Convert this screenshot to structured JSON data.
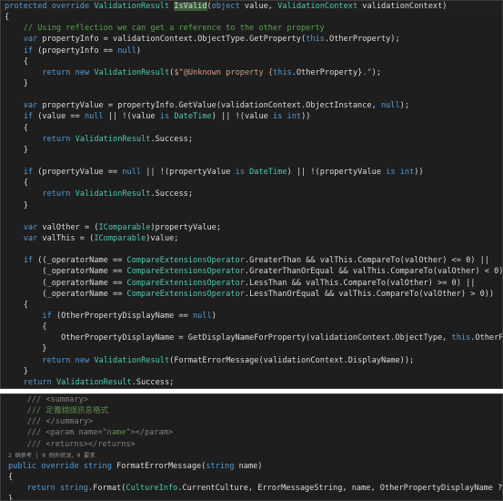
{
  "top_panel": {
    "lines": [
      [
        {
          "t": "protected override ",
          "c": "kw"
        },
        {
          "t": "ValidationResult",
          "c": "ty"
        },
        {
          "t": " ",
          "c": ""
        },
        {
          "t": "IsValid",
          "c": "hl"
        },
        {
          "t": "(",
          "c": ""
        },
        {
          "t": "object",
          "c": "kw"
        },
        {
          "t": " value, ",
          "c": ""
        },
        {
          "t": "ValidationContext",
          "c": "ty"
        },
        {
          "t": " validationContext)",
          "c": ""
        }
      ],
      [
        {
          "t": "{",
          "c": ""
        }
      ],
      [
        {
          "t": "    // Using reflection we can get a reference to the other property",
          "c": "cm"
        }
      ],
      [
        {
          "t": "    ",
          "c": ""
        },
        {
          "t": "var",
          "c": "kw"
        },
        {
          "t": " propertyInfo = validationContext.ObjectType.GetProperty(",
          "c": ""
        },
        {
          "t": "this",
          "c": "kw"
        },
        {
          "t": ".OtherProperty);",
          "c": ""
        }
      ],
      [
        {
          "t": "    ",
          "c": ""
        },
        {
          "t": "if",
          "c": "kw"
        },
        {
          "t": " (propertyInfo == ",
          "c": ""
        },
        {
          "t": "null",
          "c": "kw"
        },
        {
          "t": ")",
          "c": ""
        }
      ],
      [
        {
          "t": "    {",
          "c": ""
        }
      ],
      [
        {
          "t": "        ",
          "c": ""
        },
        {
          "t": "return",
          "c": "kw"
        },
        {
          "t": " ",
          "c": ""
        },
        {
          "t": "new",
          "c": "kw"
        },
        {
          "t": " ",
          "c": ""
        },
        {
          "t": "ValidationResult",
          "c": "ty"
        },
        {
          "t": "(",
          "c": ""
        },
        {
          "t": "$\"@Unknown property {",
          "c": "st"
        },
        {
          "t": "this",
          "c": "kw"
        },
        {
          "t": ".OtherProperty}",
          "c": ""
        },
        {
          "t": ".\"",
          "c": "st"
        },
        {
          "t": ");",
          "c": ""
        }
      ],
      [
        {
          "t": "    }",
          "c": ""
        }
      ],
      [
        {
          "t": "",
          "c": ""
        }
      ],
      [
        {
          "t": "    ",
          "c": ""
        },
        {
          "t": "var",
          "c": "kw"
        },
        {
          "t": " propertyValue = propertyInfo.GetValue(validationContext.ObjectInstance, ",
          "c": ""
        },
        {
          "t": "null",
          "c": "kw"
        },
        {
          "t": ");",
          "c": ""
        }
      ],
      [
        {
          "t": "    ",
          "c": ""
        },
        {
          "t": "if",
          "c": "kw"
        },
        {
          "t": " (value == ",
          "c": ""
        },
        {
          "t": "null",
          "c": "kw"
        },
        {
          "t": " || !(value ",
          "c": ""
        },
        {
          "t": "is",
          "c": "kw"
        },
        {
          "t": " ",
          "c": ""
        },
        {
          "t": "DateTime",
          "c": "ty"
        },
        {
          "t": ") || !(value ",
          "c": ""
        },
        {
          "t": "is",
          "c": "kw"
        },
        {
          "t": " ",
          "c": ""
        },
        {
          "t": "int",
          "c": "kw"
        },
        {
          "t": "))",
          "c": ""
        }
      ],
      [
        {
          "t": "    {",
          "c": ""
        }
      ],
      [
        {
          "t": "        ",
          "c": ""
        },
        {
          "t": "return",
          "c": "kw"
        },
        {
          "t": " ",
          "c": ""
        },
        {
          "t": "ValidationResult",
          "c": "ty"
        },
        {
          "t": ".Success;",
          "c": ""
        }
      ],
      [
        {
          "t": "    }",
          "c": ""
        }
      ],
      [
        {
          "t": "",
          "c": ""
        }
      ],
      [
        {
          "t": "    ",
          "c": ""
        },
        {
          "t": "if",
          "c": "kw"
        },
        {
          "t": " (propertyValue == ",
          "c": ""
        },
        {
          "t": "null",
          "c": "kw"
        },
        {
          "t": " || !(propertyValue ",
          "c": ""
        },
        {
          "t": "is",
          "c": "kw"
        },
        {
          "t": " ",
          "c": ""
        },
        {
          "t": "DateTime",
          "c": "ty"
        },
        {
          "t": ") || !(propertyValue ",
          "c": ""
        },
        {
          "t": "is",
          "c": "kw"
        },
        {
          "t": " ",
          "c": ""
        },
        {
          "t": "int",
          "c": "kw"
        },
        {
          "t": "))",
          "c": ""
        }
      ],
      [
        {
          "t": "    {",
          "c": ""
        }
      ],
      [
        {
          "t": "        ",
          "c": ""
        },
        {
          "t": "return",
          "c": "kw"
        },
        {
          "t": " ",
          "c": ""
        },
        {
          "t": "ValidationResult",
          "c": "ty"
        },
        {
          "t": ".Success;",
          "c": ""
        }
      ],
      [
        {
          "t": "    }",
          "c": ""
        }
      ],
      [
        {
          "t": "",
          "c": ""
        }
      ],
      [
        {
          "t": "    ",
          "c": ""
        },
        {
          "t": "var",
          "c": "kw"
        },
        {
          "t": " valOther = (",
          "c": ""
        },
        {
          "t": "IComparable",
          "c": "ty"
        },
        {
          "t": ")propertyValue;",
          "c": ""
        }
      ],
      [
        {
          "t": "    ",
          "c": ""
        },
        {
          "t": "var",
          "c": "kw"
        },
        {
          "t": " valThis = (",
          "c": ""
        },
        {
          "t": "IComparable",
          "c": "ty"
        },
        {
          "t": ")value;",
          "c": ""
        }
      ],
      [
        {
          "t": "",
          "c": ""
        }
      ],
      [
        {
          "t": "    ",
          "c": ""
        },
        {
          "t": "if",
          "c": "kw"
        },
        {
          "t": " ((_operatorName == ",
          "c": ""
        },
        {
          "t": "CompareExtensionsOperator",
          "c": "ty"
        },
        {
          "t": ".GreaterThan && valThis.CompareTo(valOther) <= 0) ||",
          "c": ""
        }
      ],
      [
        {
          "t": "        (_operatorName == ",
          "c": ""
        },
        {
          "t": "CompareExtensionsOperator",
          "c": "ty"
        },
        {
          "t": ".GreaterThanOrEqual && valThis.CompareTo(valOther) < 0) ||",
          "c": ""
        }
      ],
      [
        {
          "t": "        (_operatorName == ",
          "c": ""
        },
        {
          "t": "CompareExtensionsOperator",
          "c": "ty"
        },
        {
          "t": ".LessThan && valThis.CompareTo(valOther) >= 0) ||",
          "c": ""
        }
      ],
      [
        {
          "t": "        (_operatorName == ",
          "c": ""
        },
        {
          "t": "CompareExtensionsOperator",
          "c": "ty"
        },
        {
          "t": ".LessThanOrEqual && valThis.CompareTo(valOther) > 0))",
          "c": ""
        }
      ],
      [
        {
          "t": "    {",
          "c": ""
        }
      ],
      [
        {
          "t": "        ",
          "c": ""
        },
        {
          "t": "if",
          "c": "kw"
        },
        {
          "t": " (OtherPropertyDisplayName == ",
          "c": ""
        },
        {
          "t": "null",
          "c": "kw"
        },
        {
          "t": ")",
          "c": ""
        }
      ],
      [
        {
          "t": "        {",
          "c": ""
        }
      ],
      [
        {
          "t": "            OtherPropertyDisplayName = GetDisplayNameForProperty(validationContext.ObjectType, ",
          "c": ""
        },
        {
          "t": "this",
          "c": "kw"
        },
        {
          "t": ".OtherProperty);",
          "c": ""
        }
      ],
      [
        {
          "t": "        }",
          "c": ""
        }
      ],
      [
        {
          "t": "        ",
          "c": ""
        },
        {
          "t": "return",
          "c": "kw"
        },
        {
          "t": " ",
          "c": ""
        },
        {
          "t": "new",
          "c": "kw"
        },
        {
          "t": " ",
          "c": ""
        },
        {
          "t": "ValidationResult",
          "c": "ty"
        },
        {
          "t": "(FormatErrorMessage(validationContext.DisplayName));",
          "c": ""
        }
      ],
      [
        {
          "t": "    }",
          "c": ""
        }
      ],
      [
        {
          "t": "    ",
          "c": ""
        },
        {
          "t": "return",
          "c": "kw"
        },
        {
          "t": " ",
          "c": ""
        },
        {
          "t": "ValidationResult",
          "c": "ty"
        },
        {
          "t": ".Success;",
          "c": ""
        }
      ],
      [
        {
          "t": "}",
          "c": ""
        }
      ]
    ]
  },
  "bottom_panel": {
    "lines": [
      [
        {
          "t": "    /// ",
          "c": "xmlgray"
        },
        {
          "t": "<summary>",
          "c": "xmlgray"
        }
      ],
      [
        {
          "t": "    /// 定義錯誤訊息格式",
          "c": "xml"
        }
      ],
      [
        {
          "t": "    /// ",
          "c": "xmlgray"
        },
        {
          "t": "</summary>",
          "c": "xmlgray"
        }
      ],
      [
        {
          "t": "    /// ",
          "c": "xmlgray"
        },
        {
          "t": "<param name=\"",
          "c": "xmlgray"
        },
        {
          "t": "name",
          "c": "xml"
        },
        {
          "t": "\"></param>",
          "c": "xmlgray"
        }
      ],
      [
        {
          "t": "    /// ",
          "c": "xmlgray"
        },
        {
          "t": "<returns></returns>",
          "c": "xmlgray"
        }
      ],
      [
        {
          "t": "2 個參考 | 0 例外狀況，0 要求",
          "c": "codelens"
        }
      ],
      [
        {
          "t": "public",
          "c": "kw"
        },
        {
          "t": " ",
          "c": ""
        },
        {
          "t": "override",
          "c": "kw"
        },
        {
          "t": " ",
          "c": ""
        },
        {
          "t": "string",
          "c": "kw"
        },
        {
          "t": " FormatErrorMessage(",
          "c": ""
        },
        {
          "t": "string",
          "c": "kw"
        },
        {
          "t": " name)",
          "c": ""
        }
      ],
      [
        {
          "t": "{",
          "c": ""
        }
      ],
      [
        {
          "t": "    ",
          "c": ""
        },
        {
          "t": "return",
          "c": "kw"
        },
        {
          "t": " ",
          "c": ""
        },
        {
          "t": "string",
          "c": "kw"
        },
        {
          "t": ".Format(",
          "c": ""
        },
        {
          "t": "CultureInfo",
          "c": "ty"
        },
        {
          "t": ".CurrentCulture, ErrorMessageString, name, OtherPropertyDisplayName ?? OtherProperty);",
          "c": ""
        }
      ],
      [
        {
          "t": "}",
          "c": ""
        }
      ]
    ]
  }
}
